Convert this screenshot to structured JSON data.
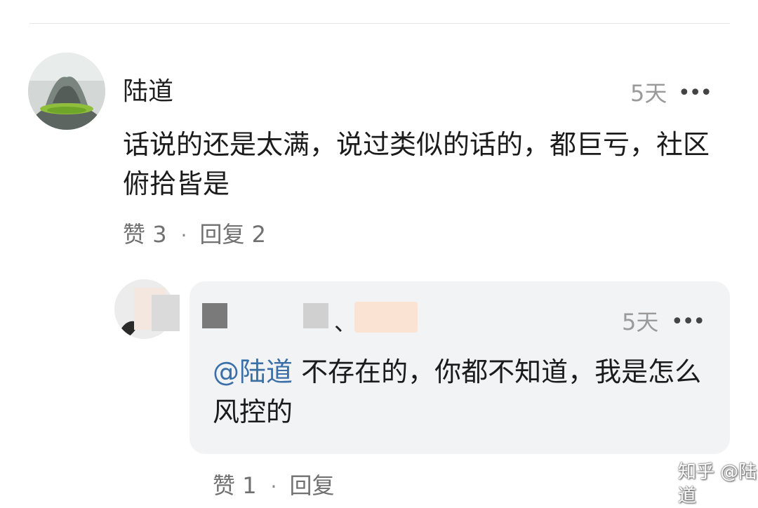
{
  "main_comment": {
    "author": "陆道",
    "time": "5天",
    "more": "•••",
    "text": "话说的还是太满，说过类似的话的，都巨亏，社区俯拾皆是",
    "like_label": "赞",
    "like_count": "3",
    "separator": "·",
    "reply_label": "回复",
    "reply_count": "2"
  },
  "reply": {
    "author_name": "、",
    "time": "5天",
    "more": "•••",
    "mention": "@陆道",
    "text": " 不存在的，你都不知道，我是怎么风控的",
    "like_label": "赞",
    "like_count": "1",
    "separator": "·",
    "reply_label": "回复"
  },
  "watermark": "知乎 @陆道",
  "colors": {
    "mention": "#3a6fa8",
    "muted": "#707070",
    "bubble": "#f2f3f5"
  }
}
